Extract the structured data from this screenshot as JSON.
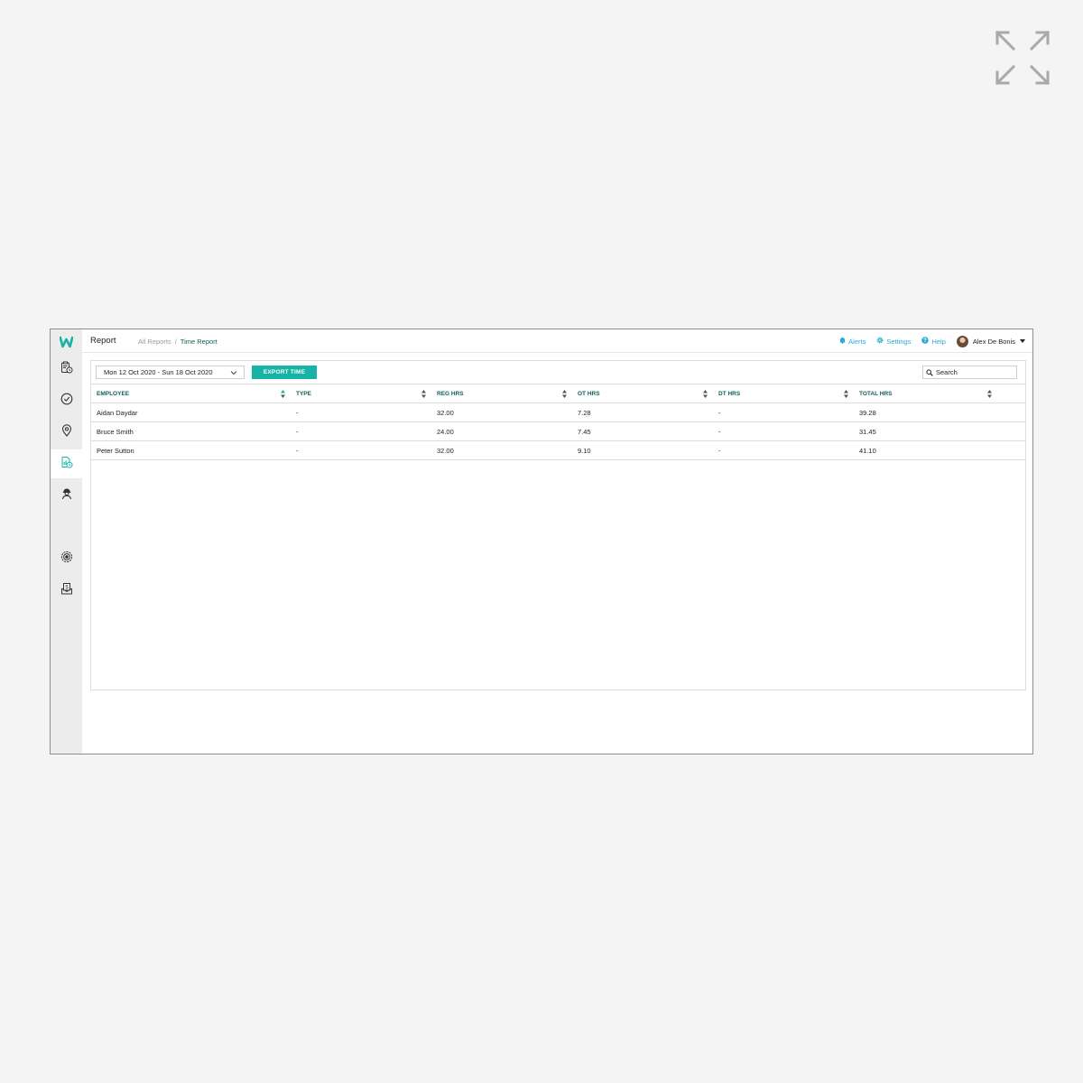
{
  "header": {
    "title": "Report",
    "breadcrumb": {
      "parent": "All Reports",
      "separator": "/",
      "current": "Time Report"
    },
    "alerts_label": "Alerts",
    "settings_label": "Settings",
    "help_label": "Help",
    "user_name": "Alex De Bonis"
  },
  "sidebar": {
    "items": [
      {
        "icon": "clipboard-clock-icon"
      },
      {
        "icon": "check-circle-icon"
      },
      {
        "icon": "map-pin-icon"
      },
      {
        "icon": "report-clock-icon",
        "active": true
      },
      {
        "icon": "worker-icon"
      },
      {
        "icon": "target-settings-icon"
      },
      {
        "icon": "payroll-icon"
      }
    ]
  },
  "toolbar": {
    "date_range": "Mon 12 Oct 2020 - Sun 18 Oct 2020",
    "export_label": "EXPORT TIME",
    "search_placeholder": "Search"
  },
  "table": {
    "columns": [
      "EMPLOYEE",
      "TYPE",
      "REG HRS",
      "OT HRS",
      "DT HRS",
      "TOTAL HRS"
    ],
    "rows": [
      [
        "Aidan Daydar",
        "-",
        "32.00",
        "7.28",
        "-",
        "39.28"
      ],
      [
        "Bruce Smith",
        "-",
        "24.00",
        "7.45",
        "-",
        "31.45"
      ],
      [
        "Peter Sutton",
        "-",
        "32.00",
        "9.10",
        "-",
        "41.10"
      ]
    ]
  },
  "colors": {
    "accent": "#16b3a6",
    "header_text": "#0f5f55",
    "link": "#2aa9d6",
    "sidebar_bg": "#ececec"
  }
}
